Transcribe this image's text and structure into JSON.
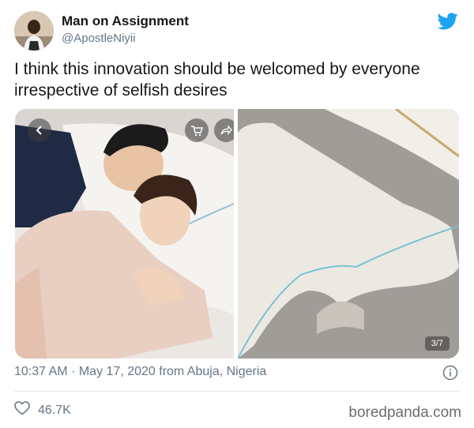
{
  "user": {
    "name": "Man on Assignment",
    "handle": "@ApostleNiyii"
  },
  "tweet": {
    "text": "I think this innovation should be welcomed by everyone irrespective of selfish desires"
  },
  "media": {
    "page_indicator": "3/7"
  },
  "meta": {
    "time": "10:37 AM",
    "separator": "·",
    "date": "May 17, 2020 from Abuja, Nigeria"
  },
  "engagement": {
    "likes": "46.7K"
  },
  "watermark": "boredpanda.com",
  "colors": {
    "twitter_blue": "#1da1f2",
    "meta_grey": "#657786",
    "divider": "#e1e8ed"
  },
  "icons": [
    "twitter-bird-icon",
    "back-arrow-icon",
    "cart-icon",
    "share-icon",
    "info-icon",
    "heart-icon"
  ]
}
